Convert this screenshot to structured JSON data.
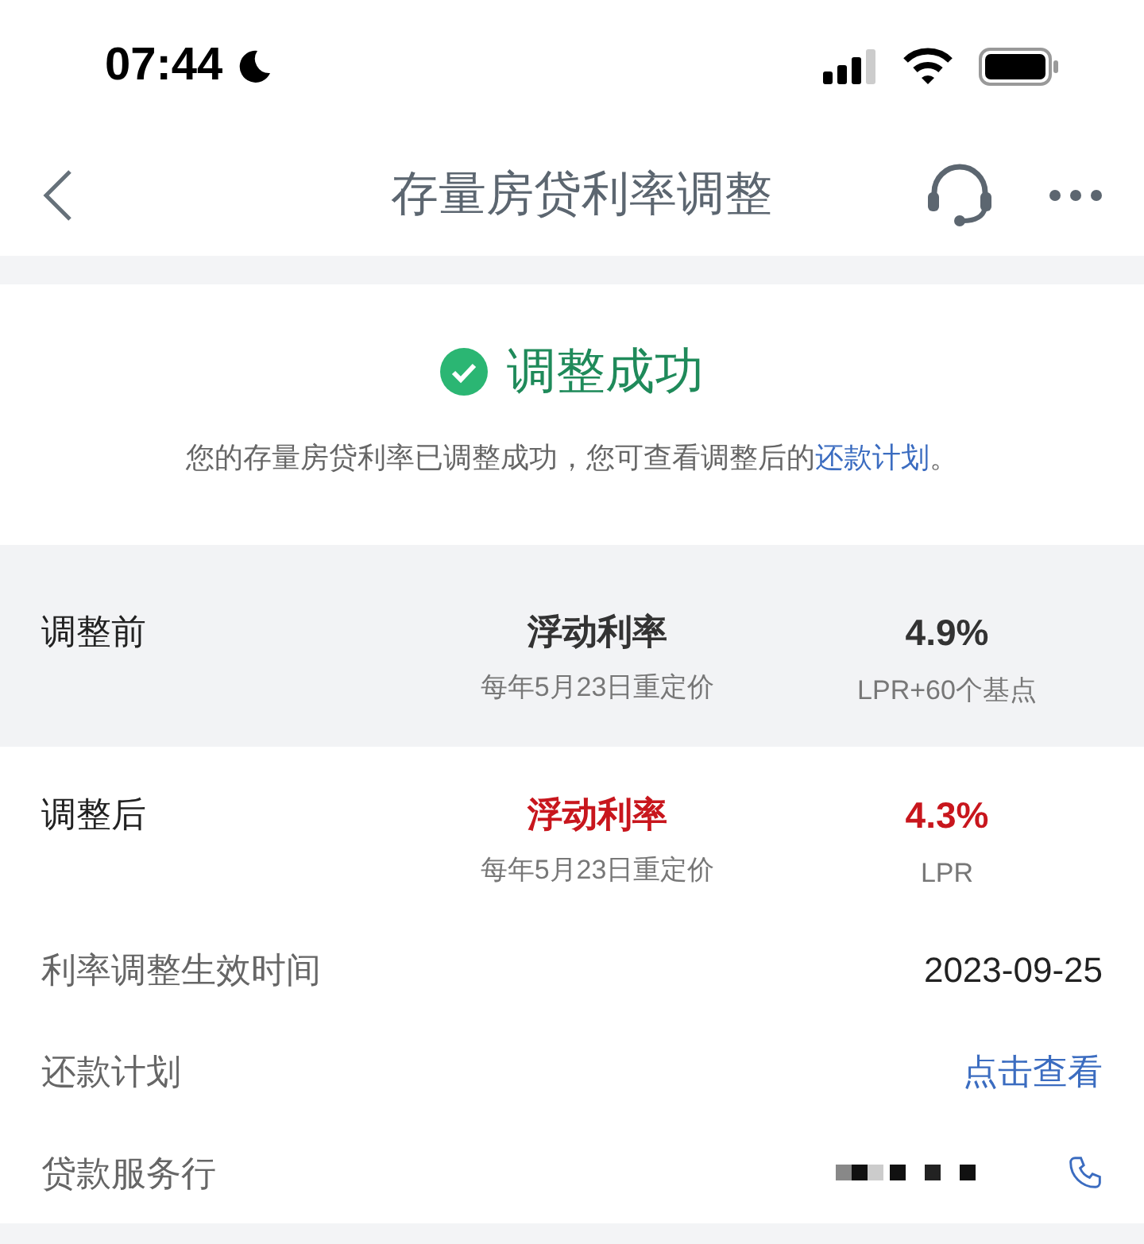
{
  "status_bar": {
    "time": "07:44"
  },
  "nav": {
    "title": "存量房贷利率调整"
  },
  "result": {
    "title": "调整成功",
    "message_parts": [
      "您的存量房贷利率已调整成功，您可查看调整后的",
      "还款计划",
      "。"
    ]
  },
  "rate_rows": [
    {
      "label": "调整前",
      "type": "浮动利率",
      "repricing": "每年5月23日重定价",
      "rate": "4.9%",
      "basis": "LPR+60个基点",
      "shaded": true,
      "highlighted": false
    },
    {
      "label": "调整后",
      "type": "浮动利率",
      "repricing": "每年5月23日重定价",
      "rate": "4.3%",
      "basis": "LPR",
      "shaded": false,
      "highlighted": true
    }
  ],
  "info_rows": [
    {
      "kind": "text",
      "label": "利率调整生效时间",
      "value": "2023-09-25"
    },
    {
      "kind": "link",
      "label": "还款计划",
      "value": "点击查看"
    },
    {
      "kind": "redacted",
      "label": "贷款服务行"
    }
  ]
}
